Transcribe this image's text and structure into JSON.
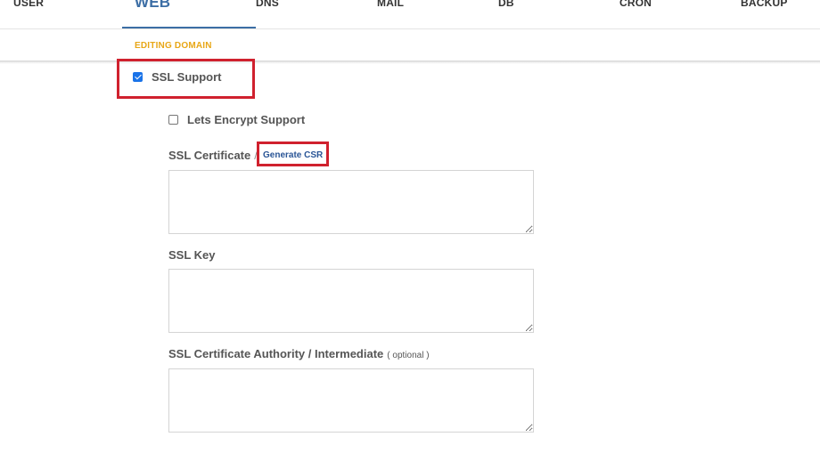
{
  "nav": {
    "tabs": [
      {
        "label": "USER"
      },
      {
        "label": "WEB"
      },
      {
        "label": "DNS"
      },
      {
        "label": "MAIL"
      },
      {
        "label": "DB"
      },
      {
        "label": "CRON"
      },
      {
        "label": "BACKUP"
      }
    ],
    "active_tab": "WEB"
  },
  "subheader": {
    "title": "EDITING DOMAIN"
  },
  "form": {
    "ssl_support": {
      "label": "SSL Support",
      "checked": true
    },
    "lets_encrypt": {
      "label": "Lets Encrypt Support",
      "checked": false
    },
    "ssl_certificate": {
      "label": "SSL Certificate",
      "separator": "/",
      "link": "Generate CSR",
      "value": ""
    },
    "ssl_key": {
      "label": "SSL Key",
      "value": ""
    },
    "ssl_ca": {
      "label": "SSL Certificate Authority / Intermediate",
      "optional": "( optional )",
      "value": ""
    }
  },
  "colors": {
    "active_tab": "#3c6ea5",
    "subheader_title": "#e8a717",
    "highlight": "#d0212e",
    "link": "#2a5596"
  }
}
